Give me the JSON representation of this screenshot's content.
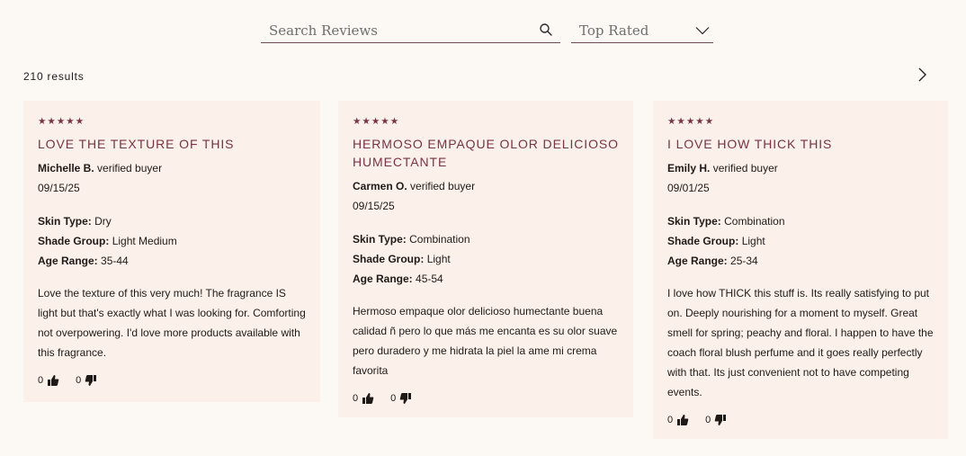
{
  "search": {
    "placeholder": "Search Reviews",
    "icon": "search-icon"
  },
  "sort": {
    "selected": "Top Rated",
    "icon": "chevron-down-icon"
  },
  "results": {
    "label": "210 results"
  },
  "pager": {
    "icon": "chevron-right-icon"
  },
  "colors": {
    "accent": "#7a3244",
    "card_bg": "#fcf1ea",
    "page_bg": "#fcf8f4"
  },
  "reviews": [
    {
      "rating": 5,
      "title": "LOVE THE TEXTURE OF THIS",
      "author": "Michelle B.",
      "badge": "verified buyer",
      "date": "09/15/25",
      "skin_type_label": "Skin Type:",
      "skin_type": "Dry",
      "shade_group_label": "Shade Group:",
      "shade_group": "Light Medium",
      "age_range_label": "Age Range:",
      "age_range": "35-44",
      "body": "Love the texture of this very much! The fragrance IS light but that's exactly what I was looking for. Comforting not overpowering. I'd love more products available with this fragrance.",
      "helpful_up": "0",
      "helpful_down": "0"
    },
    {
      "rating": 5,
      "title": "HERMOSO EMPAQUE OLOR DELICIOSO HUMECTANTE",
      "author": "Carmen O.",
      "badge": "verified buyer",
      "date": "09/15/25",
      "skin_type_label": "Skin Type:",
      "skin_type": "Combination",
      "shade_group_label": "Shade Group:",
      "shade_group": "Light",
      "age_range_label": "Age Range:",
      "age_range": "45-54",
      "body": "Hermoso empaque olor delicioso humectante buena calidad ñ pero lo que más me encanta es su olor suave pero duradero y me hidrata la piel la ame mi crema favorita",
      "helpful_up": "0",
      "helpful_down": "0"
    },
    {
      "rating": 5,
      "title": "I LOVE HOW THICK THIS",
      "author": "Emily H.",
      "badge": "verified buyer",
      "date": "09/01/25",
      "skin_type_label": "Skin Type:",
      "skin_type": "Combination",
      "shade_group_label": "Shade Group:",
      "shade_group": "Light",
      "age_range_label": "Age Range:",
      "age_range": "25-34",
      "body": "I love how THICK this stuff is. Its really satisfying to put on. Deeply nourishing for a moment to myself. Great smell for spring; peachy and floral. I happen to have the coach floral blush perfume and it goes really perfectly with that. Its just convenient not to have competing events.",
      "helpful_up": "0",
      "helpful_down": "0"
    }
  ]
}
